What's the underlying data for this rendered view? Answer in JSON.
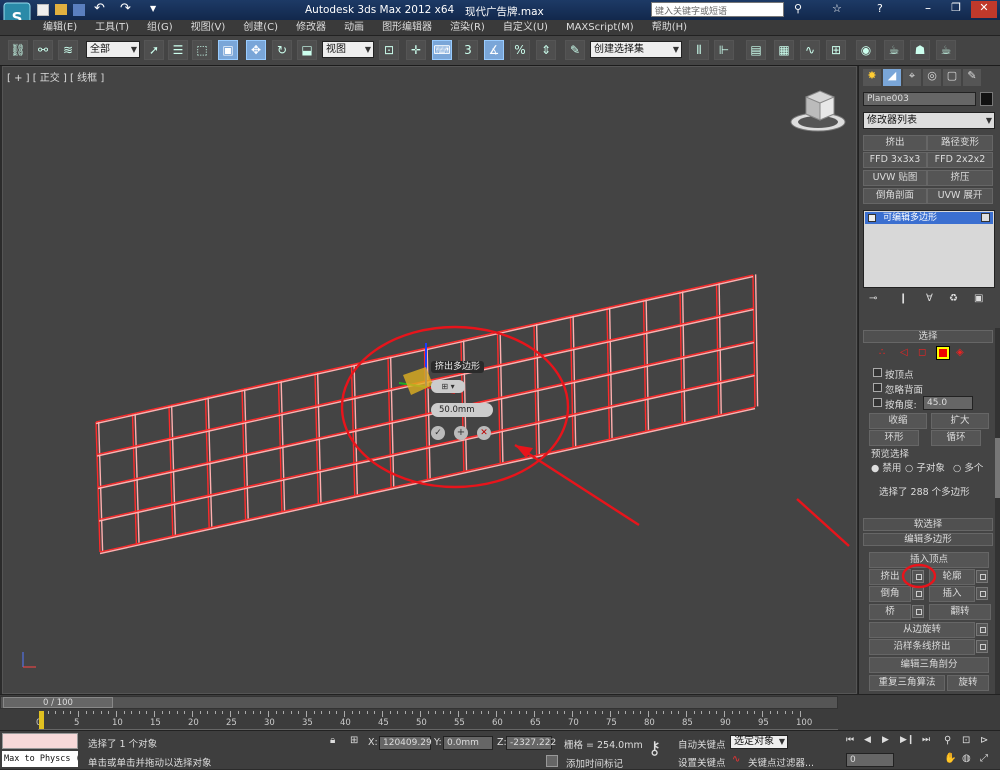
{
  "titlebar": {
    "app_title": "Autodesk 3ds Max  2012 x64",
    "file_name": "现代广告牌.max",
    "search_placeholder": "键入关键字或短语"
  },
  "menu": [
    "编辑(E)",
    "工具(T)",
    "组(G)",
    "视图(V)",
    "创建(C)",
    "修改器",
    "动画",
    "图形编辑器",
    "渲染(R)",
    "自定义(U)",
    "MAXScript(M)",
    "帮助(H)"
  ],
  "toolbar": {
    "selection_filter": "全部",
    "coord_system": "视图",
    "named_selection": "创建选择集",
    "spinner_snap_label": "%",
    "angle_snap_label": "3"
  },
  "viewport": {
    "label": "[ + ] [ 正交 ] [ 线框 ]",
    "caddy_title": "挤出多边形",
    "caddy_height": "50.0mm"
  },
  "cmdpanel": {
    "object_name": "Plane003",
    "modifier_list": "修改器列表",
    "modifier_buttons": [
      "挤出",
      "路径变形",
      "FFD 3x3x3",
      "FFD 2x2x2",
      "UVW 贴图",
      "挤压",
      "倒角剖面",
      "UVW 展开"
    ],
    "stack_item": "可编辑多边形",
    "selection": {
      "title": "选择",
      "by_vertex": "按顶点",
      "ignore_backfacing": "忽略背面",
      "by_angle": "按角度:",
      "angle_value": "45.0",
      "shrink": "收缩",
      "grow": "扩大",
      "ring": "环形",
      "loop": "循环",
      "preview_title": "预览选择",
      "preview_off": "禁用",
      "preview_subobj": "子对象",
      "preview_multi": "多个",
      "selected_info": "选择了 288 个多边形"
    },
    "soft_selection": "软选择",
    "edit_polygons": {
      "title": "编辑多边形",
      "insert_vertex": "插入顶点",
      "extrude": "挤出",
      "outline": "轮廓",
      "bevel": "倒角",
      "inset": "插入",
      "bridge": "桥",
      "flip": "翻转",
      "hinge": "从边旋转",
      "extrude_spline": "沿样条线挤出",
      "edit_tri": "编辑三角剖分",
      "retri": "重复三角算法",
      "turn": "旋转"
    }
  },
  "timeline": {
    "frame_counter": "0 / 100",
    "ticks": [
      "0",
      "5",
      "10",
      "15",
      "20",
      "25",
      "30",
      "35",
      "40",
      "45",
      "50",
      "55",
      "60",
      "65",
      "70",
      "75",
      "80",
      "85",
      "90",
      "95",
      "100"
    ]
  },
  "status": {
    "script_listener": "Max to Physcs (",
    "selection_status": "选择了 1 个对象",
    "prompt": "单击或单击并拖动以选择对象",
    "x_label": "X:",
    "x_value": "120409.29",
    "y_label": "Y:",
    "y_value": "0.0mm",
    "z_label": "Z:",
    "z_value": "-2327.222",
    "grid": "栅格 = 254.0mm",
    "add_time_tag": "添加时间标记",
    "auto_key": "自动关键点",
    "set_key": "设置关键点",
    "selected_objects": "选定对象",
    "key_filters": "关键点过滤器...",
    "frame_value": "0"
  },
  "colors": {
    "wire": "#ff2a2a",
    "annotation": "#e8141b",
    "viewport_bg": "#444444",
    "highlight_blue": "#3b6fd0"
  }
}
